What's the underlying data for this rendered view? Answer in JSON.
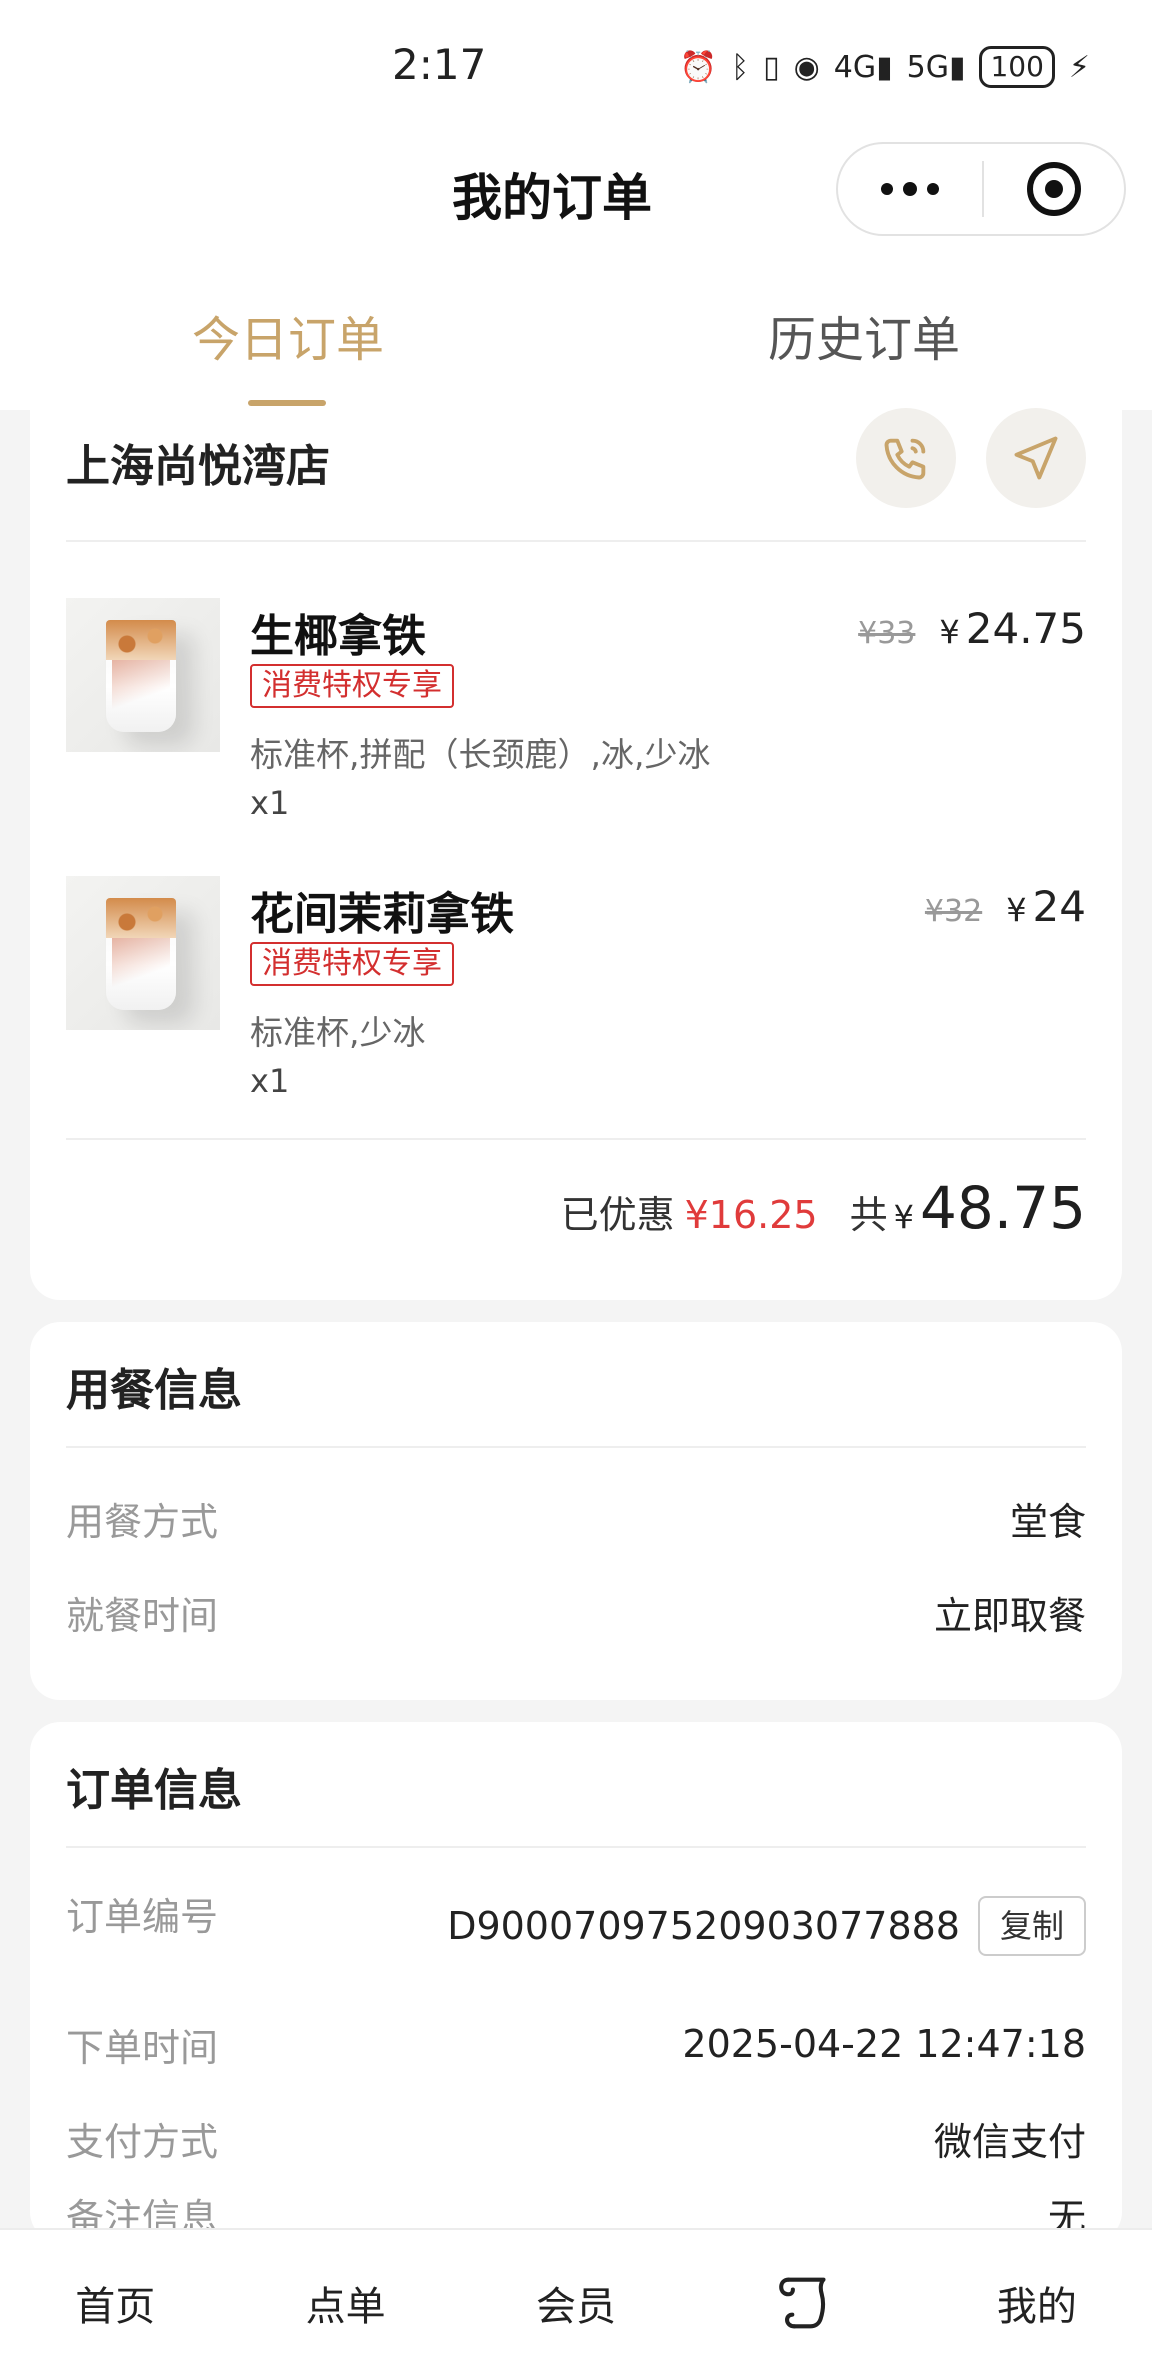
{
  "status_bar": {
    "time": "2:17",
    "icons": [
      "alarm-icon",
      "bluetooth-icon",
      "vibrate-icon",
      "hotspot-icon",
      "signal-4g-icon",
      "signal-5g-icon"
    ],
    "battery": "100"
  },
  "header": {
    "title": "我的订单"
  },
  "tabs": {
    "today": "今日订单",
    "history": "历史订单",
    "active_color": "#c8a46a"
  },
  "store": {
    "name": "上海尚悦湾店"
  },
  "products": [
    {
      "name": "生椰拿铁",
      "tag": "消费特权专享",
      "spec": "标准杯,拼配（长颈鹿）,冰,少冰",
      "qty": "x1",
      "original_price": "¥33",
      "currency": "¥",
      "price": "24.75"
    },
    {
      "name": "花间茉莉拿铁",
      "tag": "消费特权专享",
      "spec": "标准杯,少冰",
      "qty": "x1",
      "original_price": "¥32",
      "currency": "¥",
      "price": "24"
    }
  ],
  "totals": {
    "discount_label": "已优惠",
    "discount_value": "¥16.25",
    "total_label": "共",
    "currency": "¥",
    "total_value": "48.75",
    "discount_color": "#e03b3b"
  },
  "dining": {
    "title": "用餐信息",
    "method_label": "用餐方式",
    "method_value": "堂食",
    "time_label": "就餐时间",
    "time_value": "立即取餐"
  },
  "order_info": {
    "title": "订单信息",
    "number_label": "订单编号",
    "number_value": "D9000709752090307788 8",
    "copy_label": "复制",
    "placed_label": "下单时间",
    "placed_value": "2025-04-22 12:47:18",
    "payment_label": "支付方式",
    "payment_value": "微信支付",
    "remark_label": "备注信息",
    "remark_value": "无"
  },
  "tabbar": {
    "home": "首页",
    "order": "点单",
    "member": "会员",
    "center_icon": "scroll-icon",
    "mine": "我的"
  }
}
